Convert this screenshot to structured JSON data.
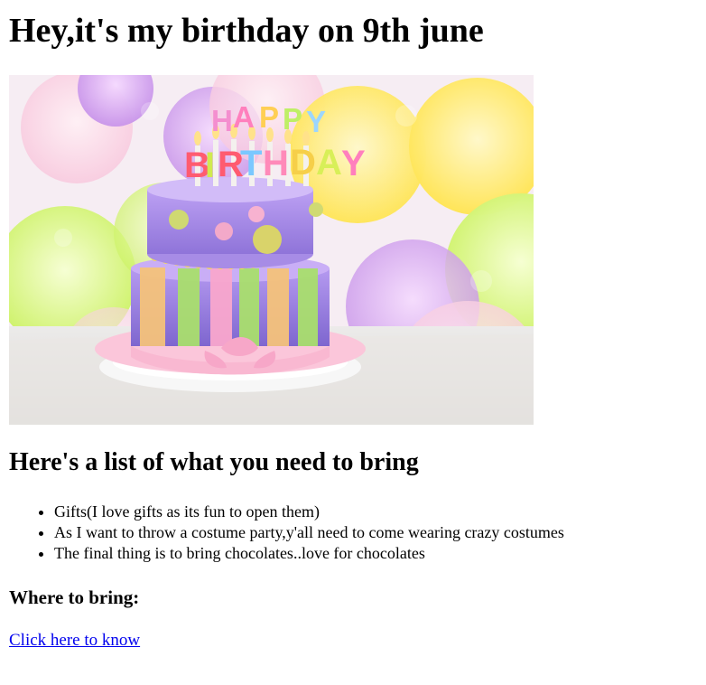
{
  "page": {
    "heading": "Hey,it's my birthday on 9th june",
    "image": {
      "name": "birthday-cake-image",
      "alt": "birthday cake",
      "cake_text_top": "HAPPY",
      "cake_text_bottom": "BIRTHDAY"
    },
    "list_heading": "Here's a list of what you need to bring",
    "items": [
      "Gifts(I love gifts as its fun to open them)",
      "As I want to throw a costume party,y'all need to come wearing crazy costumes",
      "The final thing is to bring chocolates..love for chocolates"
    ],
    "where_heading": "Where to bring:",
    "link_text": "Click here to know"
  }
}
